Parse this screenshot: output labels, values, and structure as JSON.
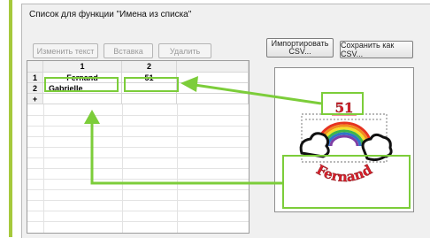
{
  "dialog": {
    "title": "Список для функции \"Имена из списка\""
  },
  "toolbar": {
    "edit_label": "Изменить текст",
    "insert_label": "Вставка",
    "delete_label": "Удалить",
    "import_label_line1": "Импортировать",
    "import_label_line2": "CSV...",
    "save_label": "Сохранить как CSV..."
  },
  "table": {
    "columns": [
      "1",
      "2"
    ],
    "rows": [
      {
        "header": "1",
        "cells": [
          "Fernand",
          "51"
        ]
      },
      {
        "header": "2",
        "cells": [
          "Gabrielle",
          ""
        ]
      },
      {
        "header": "+",
        "cells": [
          "",
          ""
        ]
      }
    ]
  },
  "preview": {
    "number_text": "51",
    "name_text": "Fernand"
  },
  "colors": {
    "highlight": "#7ccd3a",
    "embroidery_red": "#d8202b"
  }
}
